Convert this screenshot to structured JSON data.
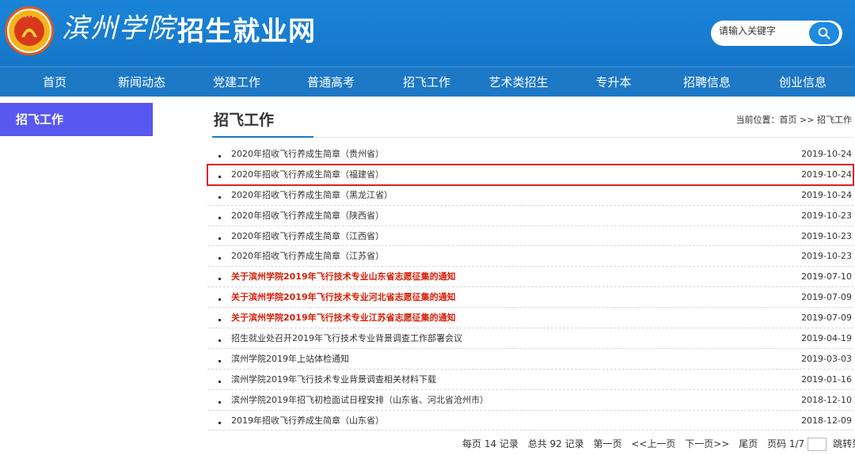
{
  "header": {
    "school_name": "滨州学院",
    "site_title": "招生就业网",
    "search_placeholder": "请输入关键字"
  },
  "nav": {
    "items": [
      "首页",
      "新闻动态",
      "党建工作",
      "普通高考",
      "招飞工作",
      "艺术类招生",
      "专升本",
      "招聘信息",
      "创业信息"
    ]
  },
  "sidebar": {
    "title": "招飞工作"
  },
  "main": {
    "title": "招飞工作",
    "breadcrumb": "当前位置：首页 >> 招飞工作",
    "articles": [
      {
        "title": "2020年招收飞行养成生简章（贵州省）",
        "date": "2019-10-24",
        "red": false,
        "highlighted": false
      },
      {
        "title": "2020年招收飞行养成生简章（福建省）",
        "date": "2019-10-24",
        "red": false,
        "highlighted": true
      },
      {
        "title": "2020年招收飞行养成生简章（黑龙江省）",
        "date": "2019-10-24",
        "red": false,
        "highlighted": false
      },
      {
        "title": "2020年招收飞行养成生简章（陕西省）",
        "date": "2019-10-23",
        "red": false,
        "highlighted": false
      },
      {
        "title": "2020年招收飞行养成生简章（江西省）",
        "date": "2019-10-23",
        "red": false,
        "highlighted": false
      },
      {
        "title": "2020年招收飞行养成生简章（江苏省）",
        "date": "2019-10-23",
        "red": false,
        "highlighted": false
      },
      {
        "title": "关于滨州学院2019年飞行技术专业山东省志愿征集的通知",
        "date": "2019-07-10",
        "red": true,
        "highlighted": false
      },
      {
        "title": "关于滨州学院2019年飞行技术专业河北省志愿征集的通知",
        "date": "2019-07-09",
        "red": true,
        "highlighted": false
      },
      {
        "title": "关于滨州学院2019年飞行技术专业江苏省志愿征集的通知",
        "date": "2019-07-09",
        "red": true,
        "highlighted": false
      },
      {
        "title": "招生就业处召开2019年飞行技术专业背景调查工作部署会议",
        "date": "2019-04-19",
        "red": false,
        "highlighted": false
      },
      {
        "title": "滨州学院2019年上站体检通知",
        "date": "2019-03-03",
        "red": false,
        "highlighted": false
      },
      {
        "title": "滨州学院2019年飞行技术专业背景调查相关材料下载",
        "date": "2019-01-16",
        "red": false,
        "highlighted": false
      },
      {
        "title": "滨州学院2019年招飞初检面试日程安排（山东省、河北省沧州市）",
        "date": "2018-12-10",
        "red": false,
        "highlighted": false
      },
      {
        "title": "2019年招收飞行养成生简章（山东省）",
        "date": "2018-12-09",
        "red": false,
        "highlighted": false
      }
    ]
  },
  "pager": {
    "per_page": "每页 14 记录",
    "total": "总共 92 记录",
    "first": "第一页",
    "prev": "<<上一页",
    "next": "下一页>>",
    "last": "尾页",
    "page_of": "页码 1/7",
    "goto": "跳转到"
  },
  "colors": {
    "header_blue": "#1a84d8",
    "nav_blue": "#1d78c6",
    "sidebar_purple": "#5858f0",
    "alert_red": "#d81e06"
  }
}
